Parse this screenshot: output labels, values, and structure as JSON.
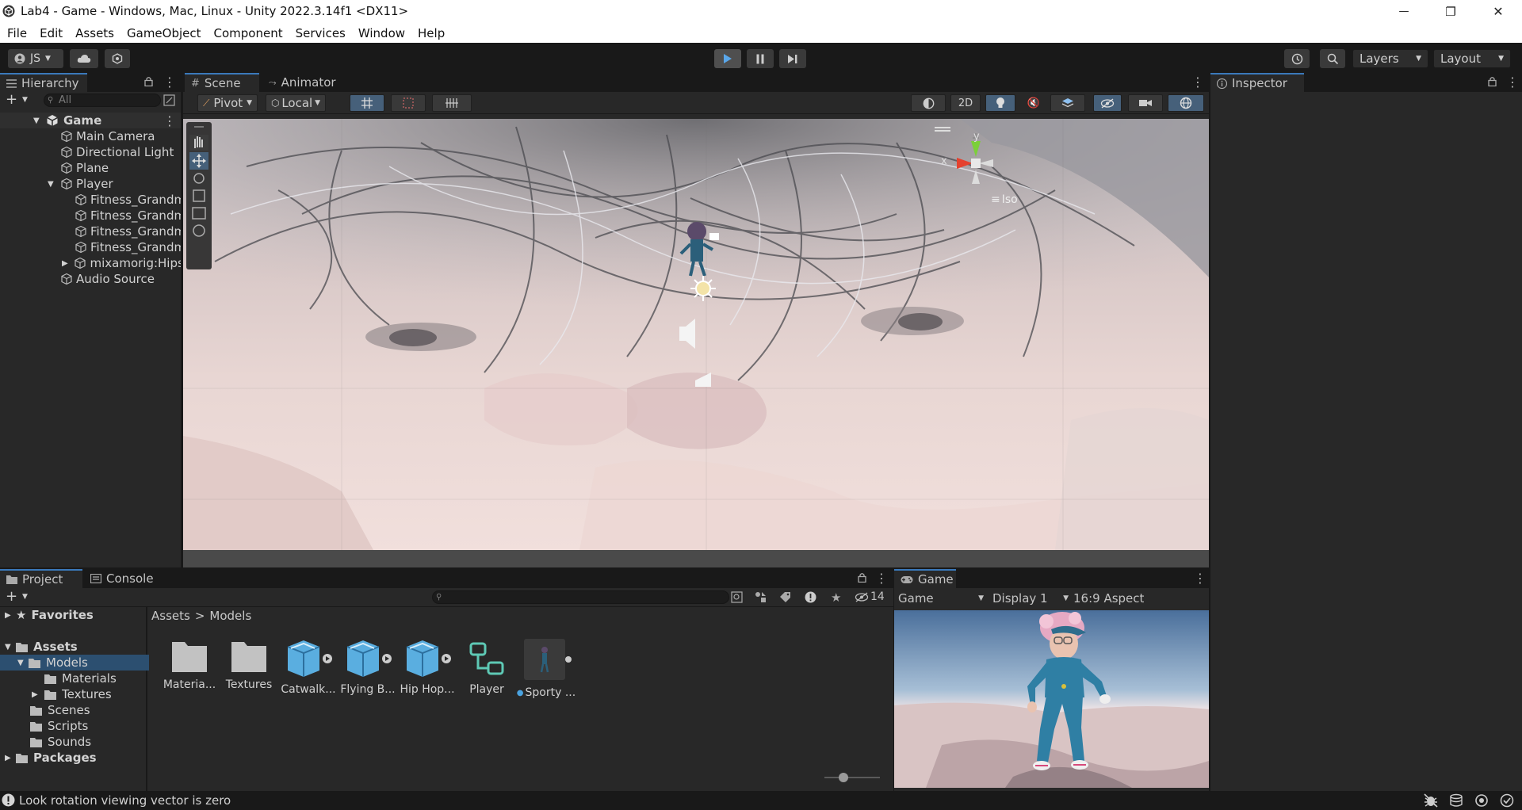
{
  "window": {
    "title": "Lab4 - Game - Windows, Mac, Linux - Unity 2022.3.14f1 <DX11>",
    "minimize_glyph": "—",
    "maximize_glyph": "❐",
    "close_glyph": "✕"
  },
  "menu": [
    "File",
    "Edit",
    "Assets",
    "GameObject",
    "Component",
    "Services",
    "Window",
    "Help"
  ],
  "toolbar": {
    "account": "JS",
    "layers": "Layers",
    "layout": "Layout"
  },
  "hierarchy": {
    "tab": "Hierarchy",
    "search_placeholder": "All",
    "scene_name": "Game",
    "items": [
      {
        "label": "Main Camera",
        "depth": 1
      },
      {
        "label": "Directional Light",
        "depth": 1
      },
      {
        "label": "Plane",
        "depth": 1
      },
      {
        "label": "Player",
        "depth": 1,
        "expanded": true
      },
      {
        "label": "Fitness_Grandma",
        "depth": 2
      },
      {
        "label": "Fitness_Grandma",
        "depth": 2
      },
      {
        "label": "Fitness_Grandma",
        "depth": 2
      },
      {
        "label": "Fitness_Grandma",
        "depth": 2
      },
      {
        "label": "mixamorig:Hips",
        "depth": 2,
        "collapsed": true
      },
      {
        "label": "Audio Source",
        "depth": 1
      }
    ]
  },
  "scene": {
    "tabs": [
      "Scene",
      "Animator"
    ],
    "pivot": "Pivot",
    "local": "Local",
    "mode_2d": "2D",
    "projection": "Iso",
    "gizmo_x": "x",
    "gizmo_y": "y"
  },
  "inspector": {
    "tab": "Inspector"
  },
  "project": {
    "tabs": [
      "Project",
      "Console"
    ],
    "hidden_count": "14",
    "favorites": "Favorites",
    "assets": "Assets",
    "folders": [
      "Models",
      "Materials",
      "Textures",
      "Scenes",
      "Scripts",
      "Sounds"
    ],
    "packages": "Packages",
    "breadcrumb": [
      "Assets",
      "Models"
    ],
    "items": [
      {
        "label": "Materia...",
        "kind": "folder"
      },
      {
        "label": "Textures",
        "kind": "folder"
      },
      {
        "label": "Catwalk...",
        "kind": "model"
      },
      {
        "label": "Flying B...",
        "kind": "model"
      },
      {
        "label": "Hip Hop...",
        "kind": "model"
      },
      {
        "label": "Player",
        "kind": "animator"
      },
      {
        "label": "Sporty ...",
        "kind": "prefab"
      }
    ]
  },
  "game": {
    "tab": "Game",
    "view": "Game",
    "display": "Display 1",
    "aspect": "16:9 Aspect"
  },
  "status": {
    "message": "Look rotation viewing vector is zero"
  },
  "colors": {
    "accent": "#3a79bb",
    "panel": "#282828",
    "background": "#191919"
  }
}
